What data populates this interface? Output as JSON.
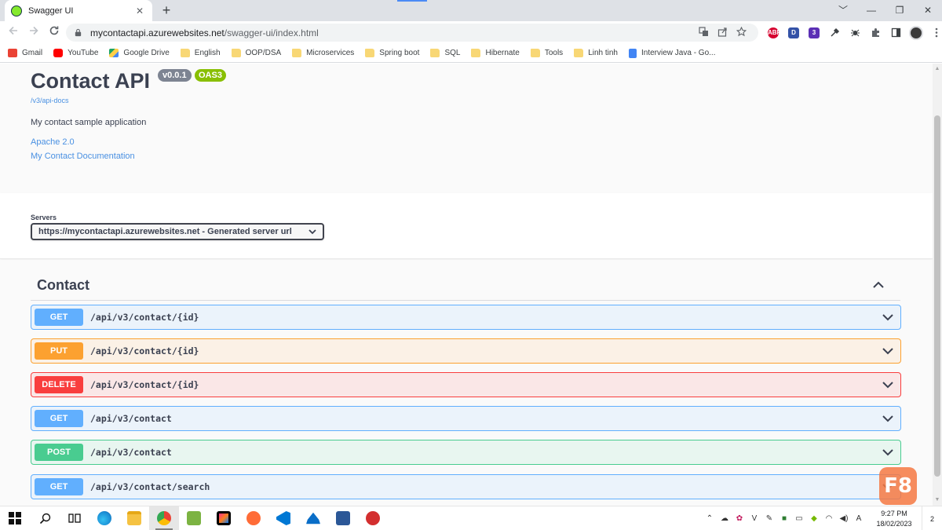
{
  "browser": {
    "tab_title": "Swagger UI",
    "tab_close": "✕",
    "new_tab": "+",
    "url_host": "mycontactapi.azurewebsites.net",
    "url_path": "/swagger-ui/index.html",
    "window": {
      "minimize": "﹀",
      "min": "—",
      "max": "❐",
      "close": "✕"
    },
    "extensions": [
      {
        "label": "ABP",
        "color": "#d6002f"
      },
      {
        "label": "D",
        "color": "#3452a7"
      },
      {
        "label": "3",
        "color": "#5b2fb5"
      }
    ],
    "bookmarks": [
      {
        "label": "Gmail",
        "icon": "gmail-icon",
        "color": "#ea4335"
      },
      {
        "label": "YouTube",
        "icon": "youtube-icon",
        "color": "#ff0000"
      },
      {
        "label": "Google Drive",
        "icon": "google-drive-icon",
        "color": "#1fa463"
      },
      {
        "label": "English",
        "icon": "folder-icon",
        "color": "#f8d775"
      },
      {
        "label": "OOP/DSA",
        "icon": "folder-icon",
        "color": "#f8d775"
      },
      {
        "label": "Microservices",
        "icon": "folder-icon",
        "color": "#f8d775"
      },
      {
        "label": "Spring boot",
        "icon": "folder-icon",
        "color": "#f8d775"
      },
      {
        "label": "SQL",
        "icon": "folder-icon",
        "color": "#f8d775"
      },
      {
        "label": "Hibernate",
        "icon": "folder-icon",
        "color": "#f8d775"
      },
      {
        "label": "Tools",
        "icon": "folder-icon",
        "color": "#f8d775"
      },
      {
        "label": "Linh tinh",
        "icon": "folder-icon",
        "color": "#f8d775"
      },
      {
        "label": "Interview Java - Go...",
        "icon": "docs-icon",
        "color": "#4285f4"
      }
    ]
  },
  "info": {
    "title": "Contact API",
    "version": "v0.0.1",
    "oas": "OAS3",
    "docs_url": "/v3/api-docs",
    "description": "My contact sample application",
    "license": "Apache 2.0",
    "external_docs": "My Contact Documentation"
  },
  "servers": {
    "label": "Servers",
    "selected": "https://mycontactapi.azurewebsites.net - Generated server url"
  },
  "tag": {
    "name": "Contact"
  },
  "operations": [
    {
      "method": "GET",
      "path": "/api/v3/contact/{id}",
      "kind": "get"
    },
    {
      "method": "PUT",
      "path": "/api/v3/contact/{id}",
      "kind": "put"
    },
    {
      "method": "DELETE",
      "path": "/api/v3/contact/{id}",
      "kind": "delete"
    },
    {
      "method": "GET",
      "path": "/api/v3/contact",
      "kind": "get"
    },
    {
      "method": "POST",
      "path": "/api/v3/contact",
      "kind": "post"
    },
    {
      "method": "GET",
      "path": "/api/v3/contact/search",
      "kind": "get"
    }
  ],
  "overlay": {
    "logo_text": "F8"
  },
  "taskbar": {
    "apps": [
      {
        "name": "windows-start",
        "color": "#000000"
      },
      {
        "name": "search",
        "color": "#000000"
      },
      {
        "name": "task-view",
        "color": "#000000"
      },
      {
        "name": "edge",
        "color": "#1b8fd6"
      },
      {
        "name": "file-explorer",
        "color": "#f5c242"
      },
      {
        "name": "chrome",
        "color": "#ea4335",
        "active": true
      },
      {
        "name": "notepad-plus-plus",
        "color": "#7cb342"
      },
      {
        "name": "intellij-idea",
        "color": "#e91e63"
      },
      {
        "name": "postman",
        "color": "#ff6c37"
      },
      {
        "name": "vs-code",
        "color": "#0078d4"
      },
      {
        "name": "azure-data-studio",
        "color": "#0a6ec8"
      },
      {
        "name": "ssms",
        "color": "#2b5797"
      },
      {
        "name": "git-tool",
        "color": "#d32f2f"
      }
    ],
    "time": "9:27 PM",
    "date": "18/02/2023",
    "notifications": "2"
  }
}
